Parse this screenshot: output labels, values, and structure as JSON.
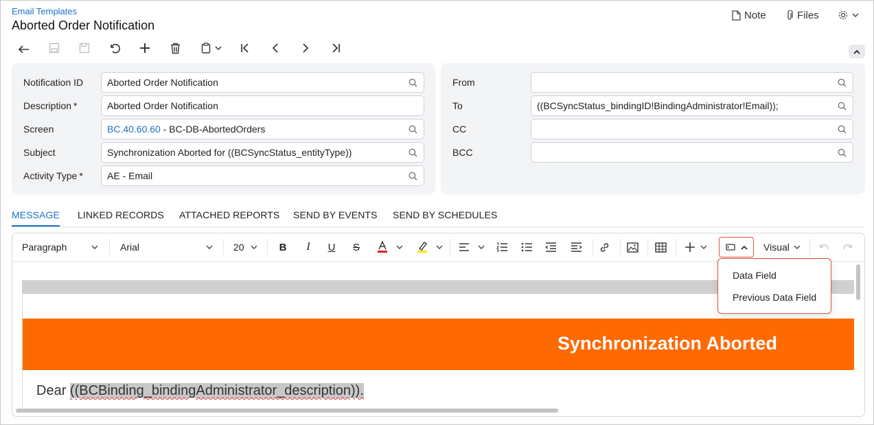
{
  "header": {
    "breadcrumb": "Email Templates",
    "title": "Aborted Order Notification",
    "note_label": "Note",
    "files_label": "Files"
  },
  "toolbar": {
    "icons": [
      "back-icon",
      "save-close-icon",
      "save-icon",
      "undo-icon",
      "add-icon",
      "delete-icon",
      "copy-paste-icon",
      "first-record-icon",
      "prev-record-icon",
      "next-record-icon",
      "last-record-icon"
    ]
  },
  "form_left": {
    "notification_id": {
      "label": "Notification ID",
      "value": "Aborted Order Notification"
    },
    "description": {
      "label": "Description",
      "required": "*",
      "value": "Aborted Order Notification"
    },
    "screen": {
      "label": "Screen",
      "link": "BC.40.60.60",
      "value": " - BC-DB-AbortedOrders"
    },
    "subject": {
      "label": "Subject",
      "value": "Synchronization Aborted for ((BCSyncStatus_entityType))"
    },
    "activity_type": {
      "label": "Activity Type",
      "required": "*",
      "value": "AE - Email"
    }
  },
  "form_right": {
    "from": {
      "label": "From",
      "value": ""
    },
    "to": {
      "label": "To",
      "value": "((BCSyncStatus_bindingID!BindingAdministrator!Email));"
    },
    "cc": {
      "label": "CC",
      "value": ""
    },
    "bcc": {
      "label": "BCC",
      "value": ""
    }
  },
  "tabs": [
    "MESSAGE",
    "LINKED RECORDS",
    "ATTACHED REPORTS",
    "SEND BY EVENTS",
    "SEND BY SCHEDULES"
  ],
  "editor": {
    "paragraph": "Paragraph",
    "font": "Arial",
    "size": "20",
    "mode": "Visual",
    "banner_text": "Synchronization Aborted",
    "dear": "Dear ",
    "placeholder": "((BCBinding_bindingAdministrator_description)).",
    "colors": {
      "banner": "#fe6900",
      "font_color": "#e02020",
      "highlight": "#f5e500"
    }
  },
  "insert_menu": {
    "items": [
      "Data Field",
      "Previous Data Field"
    ]
  }
}
